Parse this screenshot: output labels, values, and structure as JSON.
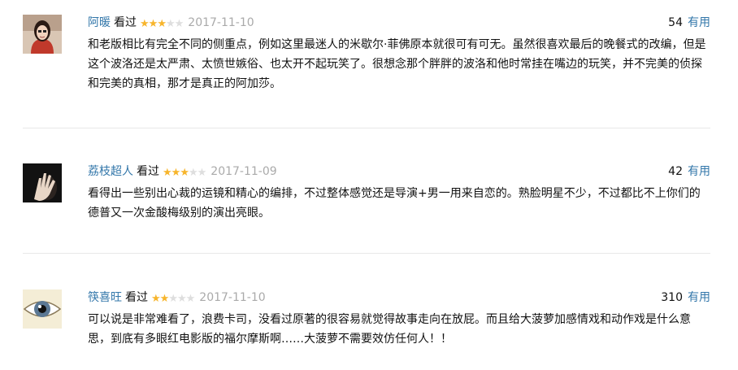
{
  "reviews": [
    {
      "username": "阿暖",
      "watched": "看过",
      "rating": 3,
      "max_rating": 5,
      "date": "2017-11-10",
      "useful_count": "54",
      "useful_label": "有用",
      "avatar_icon": "woman-portrait-avatar",
      "text": "和老版相比有完全不同的侧重点，例如这里最迷人的米歇尔·菲佛原本就很可有可无。虽然很喜欢最后的晚餐式的改编，但是这个波洛还是太严肃、太愤世嫉俗、也太开不起玩笑了。很想念那个胖胖的波洛和他时常挂在嘴边的玩笑，并不完美的侦探和完美的真相，那才是真正的阿加莎。"
    },
    {
      "username": "荔枝超人",
      "watched": "看过",
      "rating": 3,
      "max_rating": 5,
      "date": "2017-11-09",
      "useful_count": "42",
      "useful_label": "有用",
      "avatar_icon": "hand-over-face-avatar",
      "text": "看得出一些别出心裁的运镜和精心的编排，不过整体感觉还是导演+男一用来自恋的。熟脸明星不少，不过都比不上你们的德普又一次金酸梅级别的演出亮眼。"
    },
    {
      "username": "筷喜旺",
      "watched": "看过",
      "rating": 2,
      "max_rating": 5,
      "date": "2017-11-10",
      "useful_count": "310",
      "useful_label": "有用",
      "avatar_icon": "eye-avatar",
      "text": "可以说是非常难看了，浪费卡司，没看过原著的很容易就觉得故事走向在放屁。而且给大菠萝加感情戏和动作戏是什么意思，到底有多眼红电影版的福尔摩斯啊……大菠萝不需要效仿任何人！！"
    }
  ],
  "colors": {
    "link": "#3377aa",
    "star_on": "#f7b52c",
    "star_off": "#dedede",
    "date": "#aaaaaa",
    "divider": "#e8e8e8"
  }
}
